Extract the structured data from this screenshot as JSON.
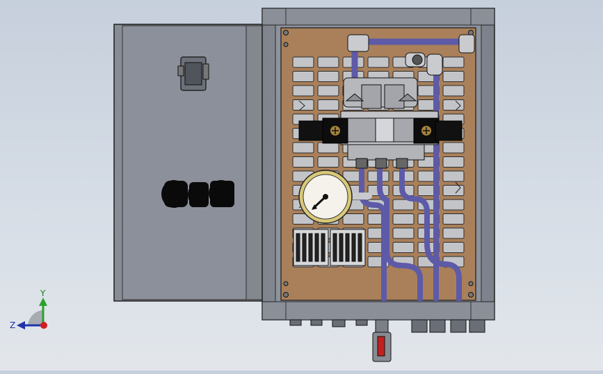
{
  "viewport": {
    "scene": "cad-3d-model-view",
    "background_top": "#c6cfdc",
    "background_bottom": "#e2e6eb"
  },
  "triad": {
    "y_label": "Y",
    "z_label": "Z",
    "y_color": "#2aa12a",
    "z_color": "#2233aa",
    "x_color": "#d11f1f"
  },
  "model": {
    "enclosure_color": "#8e939c",
    "door_color": "#878c95",
    "backplate_color": "#a9805a",
    "tube_color": "#5d5aa8",
    "valve_color": "#b6b8bc",
    "gauge_face": "#f4f2ea",
    "gauge_ring": "#d8c878"
  }
}
